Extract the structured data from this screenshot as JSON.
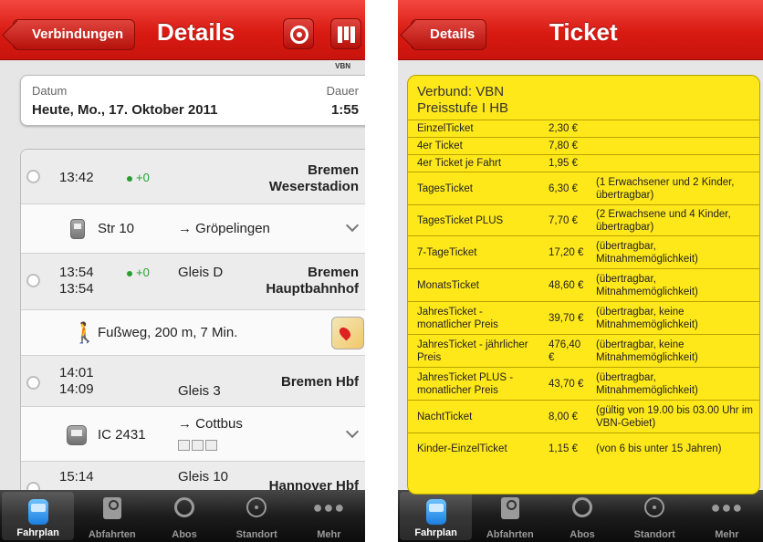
{
  "left": {
    "nav": {
      "back_label": "Verbindungen",
      "title": "Details"
    },
    "vbn_tag": "VBN",
    "date_card": {
      "date_label": "Datum",
      "date_value": "Heute, Mo., 17. Oktober 2011",
      "duration_label": "Dauer",
      "duration_value": "1:55"
    },
    "stops": [
      {
        "time1": "13:42",
        "delay": "+0",
        "station": [
          "Bremen",
          "Weserstadion"
        ]
      },
      {
        "time1": "13:54",
        "time2": "13:54",
        "delay": "+0",
        "platform": "Gleis D",
        "station": [
          "Bremen",
          "Hauptbahnhof"
        ]
      },
      {
        "time1": "14:01",
        "time2": "14:09",
        "platform": "Gleis 3",
        "station": [
          "Bremen Hbf"
        ]
      },
      {
        "time1": "15:14",
        "platform": "Gleis 10",
        "station": [
          "Hannover Hbf"
        ]
      }
    ],
    "legs": [
      {
        "line": "Str 10",
        "direction": "→ Gröpelingen",
        "icon": "tram-icon"
      },
      {
        "text": "Fußweg, 200 m, 7 Min.",
        "icon": "walk-icon"
      },
      {
        "line": "IC 2431",
        "direction": "→ Cottbus",
        "icon": "train-icon"
      }
    ]
  },
  "right": {
    "nav": {
      "back_label": "Details",
      "title": "Ticket"
    },
    "header": {
      "line1": "Verbund: VBN",
      "line2": "Preisstufe I HB"
    },
    "tickets": [
      {
        "name": "EinzelTicket",
        "price": "2,30 €",
        "note": ""
      },
      {
        "name": "4er Ticket",
        "price": "7,80 €",
        "note": ""
      },
      {
        "name": "4er Ticket je Fahrt",
        "price": "1,95 €",
        "note": ""
      },
      {
        "name": "TagesTicket",
        "price": "6,30 €",
        "note": "(1 Erwachsener und 2 Kinder, übertragbar)"
      },
      {
        "name": "TagesTicket PLUS",
        "price": "7,70 €",
        "note": "(2 Erwachsene und 4 Kinder, übertragbar)"
      },
      {
        "name": "7-TageTicket",
        "price": "17,20 €",
        "note": "(übertragbar, Mitnahmemöglichkeit)"
      },
      {
        "name": "MonatsTicket",
        "price": "48,60 €",
        "note": "(übertragbar, Mitnahmemöglichkeit)"
      },
      {
        "name": "JahresTicket - monatlicher Preis",
        "price": "39,70 €",
        "note": "(übertragbar, keine Mitnahmemöglichkeit)"
      },
      {
        "name": "JahresTicket - jährlicher Preis",
        "price": "476,40 €",
        "note": "(übertragbar, keine Mitnahmemöglichkeit)"
      },
      {
        "name": "JahresTicket PLUS - monatlicher Preis",
        "price": "43,70 €",
        "note": "(übertragbar, Mitnahmemöglichkeit)"
      },
      {
        "name": "NachtTicket",
        "price": "8,00 €",
        "note": "(gültig von 19.00 bis 03.00 Uhr im VBN-Gebiet)"
      },
      {
        "name": "Kinder-EinzelTicket",
        "price": "1,15 €",
        "note": "(von 6 bis unter 15 Jahren)"
      }
    ]
  },
  "tabbar": [
    {
      "label": "Fahrplan",
      "icon": "tram-icon",
      "active": true
    },
    {
      "label": "Abfahrten",
      "icon": "document-icon",
      "active": false
    },
    {
      "label": "Abos",
      "icon": "alarm-clock-icon",
      "active": false
    },
    {
      "label": "Standort",
      "icon": "location-target-icon",
      "active": false
    },
    {
      "label": "Mehr",
      "icon": "more-dots-icon",
      "active": false
    }
  ]
}
